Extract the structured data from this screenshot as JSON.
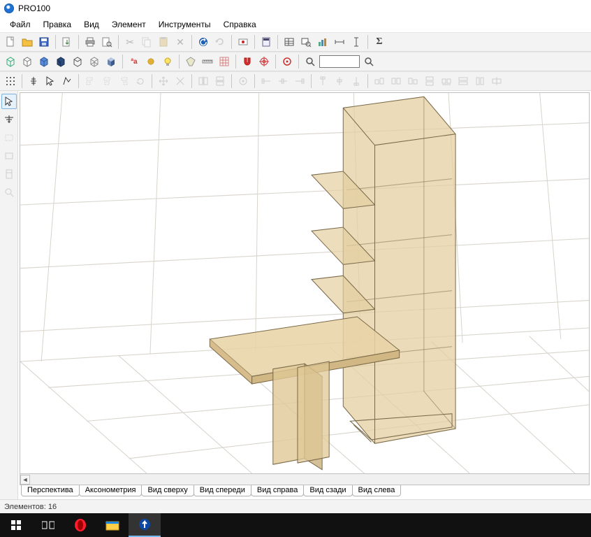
{
  "app": {
    "title": "PRO100"
  },
  "menu": {
    "items": [
      "Файл",
      "Правка",
      "Вид",
      "Элемент",
      "Инструменты",
      "Справка"
    ]
  },
  "search": {
    "placeholder": ""
  },
  "view_tabs": [
    "Перспектива",
    "Аксонометрия",
    "Вид сверху",
    "Вид спереди",
    "Вид справа",
    "Вид сзади",
    "Вид слева"
  ],
  "status": {
    "label": "Элементов:",
    "count": 16
  },
  "toolbar1": {
    "icons": [
      "new-file",
      "open-folder",
      "save",
      "sep",
      "import",
      "sep",
      "print",
      "print-preview",
      "sep",
      "cut",
      "copy",
      "paste",
      "delete",
      "sep",
      "undo",
      "redo",
      "sep",
      "record",
      "sep",
      "calculator",
      "sep",
      "table",
      "zoom-in",
      "chart",
      "dim-h",
      "dim-v",
      "sep",
      "sigma"
    ]
  },
  "toolbar2": {
    "icons": [
      "wire-cube",
      "cube-outline",
      "cube-blue",
      "cube-dark",
      "cube-open",
      "cube-wire2",
      "cube-shade",
      "sep",
      "text-aa",
      "dot-gold",
      "bulb",
      "sep",
      "tag",
      "ruler",
      "grid",
      "sep",
      "magnet",
      "target",
      "sep",
      "circle-target",
      "sep",
      "search-glass"
    ]
  },
  "toolbar3": {
    "icons": [
      "grid-toggle",
      "sep",
      "align",
      "arrow-cursor",
      "poly",
      "sep",
      "align-l",
      "align-c",
      "align-r",
      "rot-l",
      "sep",
      "move-cross",
      "move-diag",
      "sep",
      "mirror-h",
      "mirror-v",
      "sep",
      "flip",
      "sep",
      "h1",
      "h2",
      "h3",
      "sep",
      "st1",
      "st2",
      "st3",
      "sep",
      "b1",
      "b2",
      "b3",
      "b4",
      "b5",
      "b6",
      "b7",
      "b8"
    ]
  },
  "left_tools": [
    "arrow",
    "light",
    "rect",
    "rect2",
    "panel",
    "zoom"
  ],
  "taskbar": {
    "items": [
      "start",
      "task-view",
      "opera",
      "explorer",
      "pro100"
    ]
  }
}
